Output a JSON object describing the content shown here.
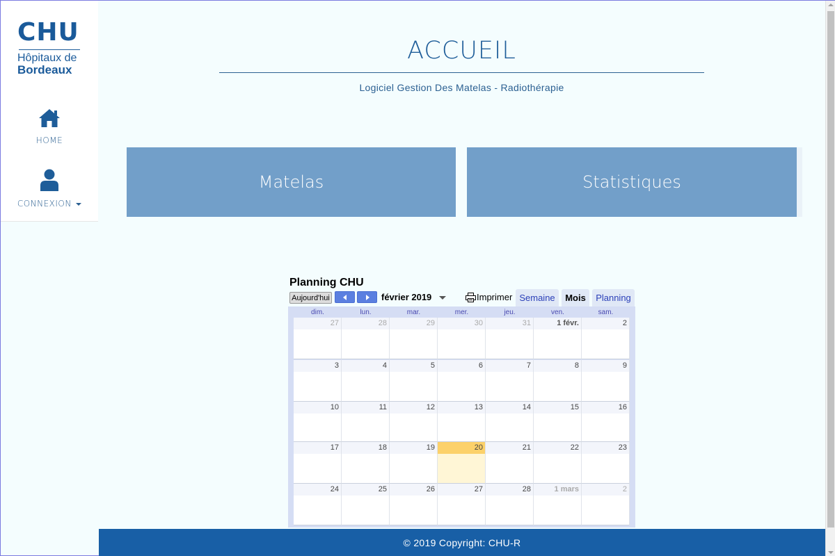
{
  "sidebar": {
    "logo": {
      "line1": "CHU",
      "line2": "Hôpitaux de",
      "line3": "Bordeaux"
    },
    "items": [
      {
        "label": "HOME",
        "icon": "home-icon"
      },
      {
        "label": "CONNEXION",
        "icon": "user-icon"
      }
    ]
  },
  "header": {
    "title": "ACCUEIL",
    "subtitle": "Logiciel Gestion Des Matelas - Radiothérapie"
  },
  "tiles": [
    {
      "label": "Matelas"
    },
    {
      "label": "Statistiques"
    }
  ],
  "calendar": {
    "title": "Planning CHU",
    "today_button": "Aujourd'hui",
    "month_label": "février 2019",
    "print_label": "Imprimer",
    "tabs": [
      "Semaine",
      "Mois",
      "Planning"
    ],
    "active_tab": "Mois",
    "weekdays": [
      "dim.",
      "lun.",
      "mar.",
      "mer.",
      "jeu.",
      "ven.",
      "sam."
    ],
    "weeks": [
      [
        "27",
        "28",
        "29",
        "30",
        "31",
        "1 févr.",
        "2"
      ],
      [
        "3",
        "4",
        "5",
        "6",
        "7",
        "8",
        "9"
      ],
      [
        "10",
        "11",
        "12",
        "13",
        "14",
        "15",
        "16"
      ],
      [
        "17",
        "18",
        "19",
        "20",
        "21",
        "22",
        "23"
      ],
      [
        "24",
        "25",
        "26",
        "27",
        "28",
        "1 mars",
        "2"
      ]
    ],
    "today": "20"
  },
  "footer": {
    "text": "© 2019 Copyright: CHU-R"
  },
  "colors": {
    "brand": "#1a5a9a",
    "tile": "#729fc9",
    "footer": "#185fa6",
    "today": "#fcd16a",
    "background": "#f4fdfe"
  }
}
